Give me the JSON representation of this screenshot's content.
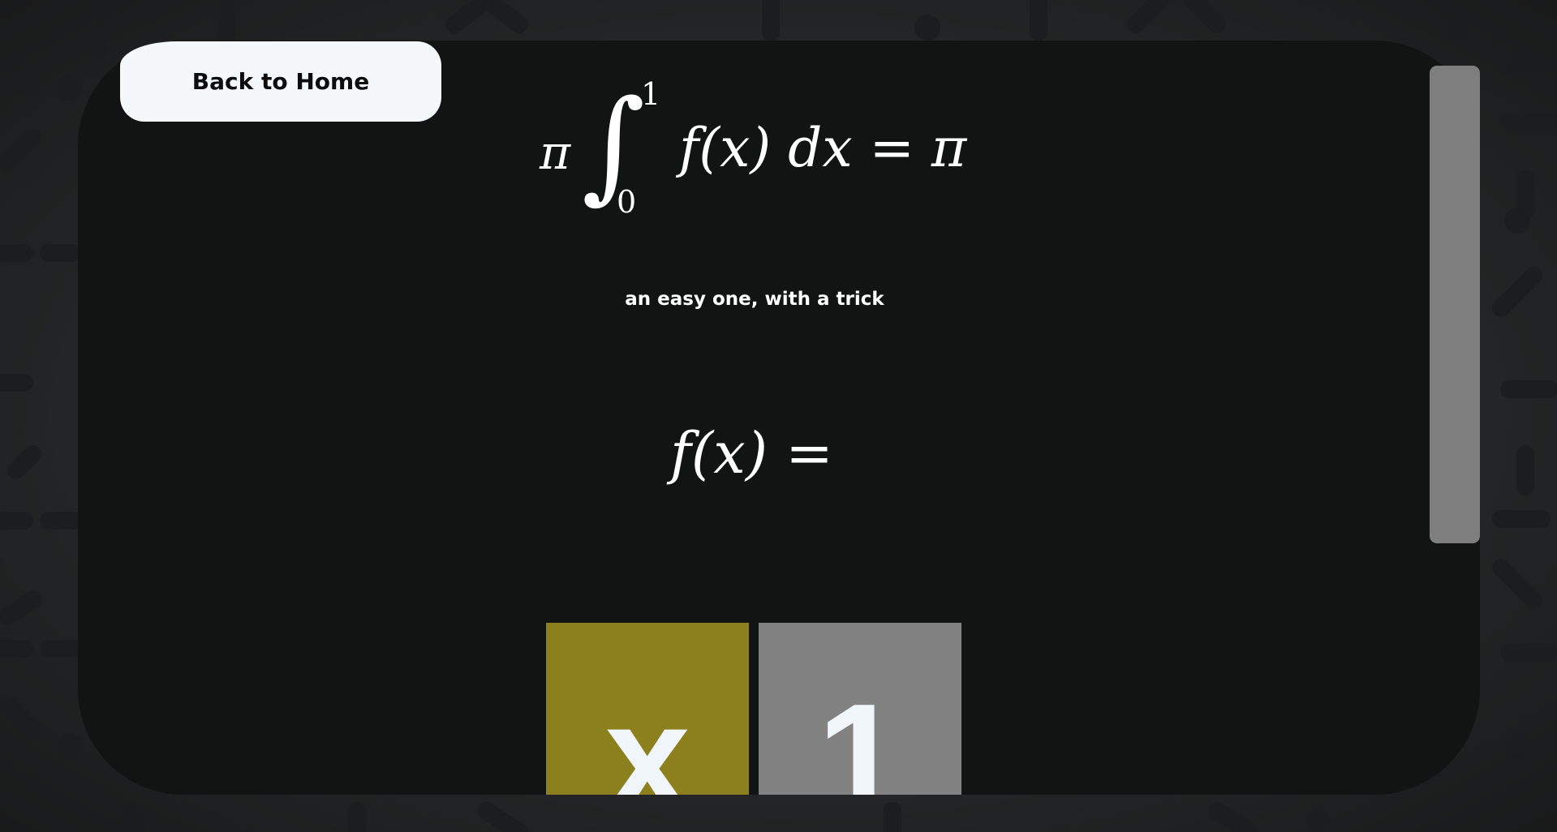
{
  "nav": {
    "home_label": "Back to Home"
  },
  "puzzle": {
    "lhs_coefficient": "π",
    "integral_upper": "1",
    "integral_lower": "0",
    "integrand": "f(x) dx = π",
    "hint": "an easy one, with a trick",
    "answer_prompt": "f(x) ="
  },
  "tiles": [
    {
      "label": "x",
      "color": "#8c801e"
    },
    {
      "label": "1",
      "color": "#828282"
    }
  ],
  "colors": {
    "panel": "#121313",
    "background": "#2b2d2e",
    "button": "#f5f8fb",
    "scrollbar": "#7e7e7e"
  }
}
